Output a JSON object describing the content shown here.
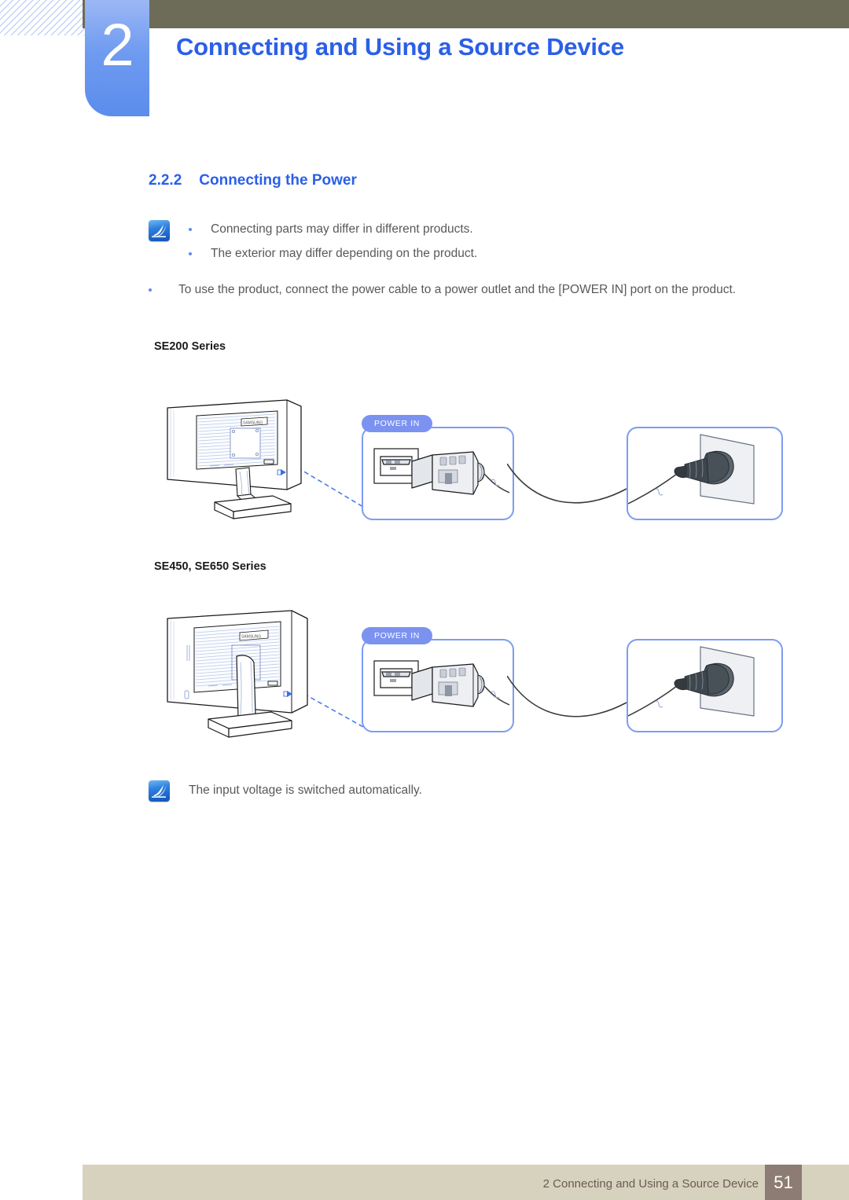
{
  "header": {
    "chapter_number": "2",
    "chapter_title": "Connecting and Using a Source Device",
    "bar_color": "#6d6c58",
    "badge_color": "#5b8ded",
    "title_color": "#2a5fe8"
  },
  "section": {
    "number": "2.2.2",
    "title": "Connecting the Power",
    "color": "#2a5fe8"
  },
  "note_top": {
    "icon": "note-pen-icon",
    "items": [
      "Connecting parts may differ in different products.",
      "The exterior may differ depending on the product."
    ]
  },
  "body_bullet": {
    "text": "To use the product, connect the power cable to a power outlet and the [POWER IN] port on the product."
  },
  "diagrams": [
    {
      "series_label": "SE200 Series",
      "callout_label": "POWER IN",
      "monitor": "monitor-rear-se200",
      "brand": "SAMSUNG",
      "connector": "iec-power-connector",
      "outlet": "wall-outlet-plug"
    },
    {
      "series_label": "SE450, SE650 Series",
      "callout_label": "POWER IN",
      "monitor": "monitor-rear-se450",
      "brand": "SAMSUNG",
      "connector": "iec-power-connector",
      "outlet": "wall-outlet-plug"
    }
  ],
  "note_bottom": {
    "icon": "note-pen-icon",
    "text": "The input voltage is switched automatically."
  },
  "footer": {
    "text": "2 Connecting and Using a Source Device",
    "page_number": "51",
    "bar_color": "#d7d2bd",
    "page_box_color": "#8d7c73"
  }
}
